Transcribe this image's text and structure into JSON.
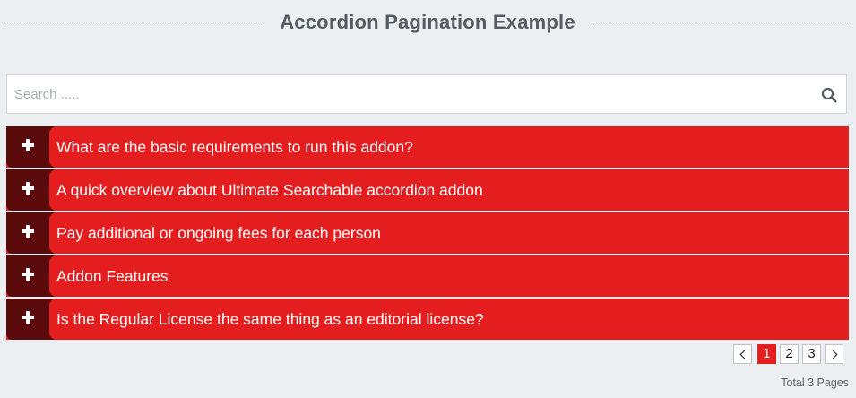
{
  "header": {
    "title": "Accordion Pagination Example"
  },
  "search": {
    "placeholder": "Search .....",
    "value": "",
    "icon": "search-icon"
  },
  "accordion": {
    "colors": {
      "item_bg": "#e41e1f",
      "toggle_bg": "#5b0b0b",
      "text": "#ffffff"
    },
    "items": [
      {
        "label": "What are the basic requirements to run this addon?",
        "icon": "plus-icon",
        "expanded": false
      },
      {
        "label": "A quick overview about Ultimate Searchable accordion addon",
        "icon": "plus-icon",
        "expanded": false
      },
      {
        "label": "Pay additional or ongoing fees for each person",
        "icon": "plus-icon",
        "expanded": false
      },
      {
        "label": "Addon Features",
        "icon": "plus-icon",
        "expanded": false
      },
      {
        "label": "Is the Regular License the same thing as an editorial license?",
        "icon": "plus-icon",
        "expanded": false
      }
    ]
  },
  "pagination": {
    "prev_icon": "chevron-left-icon",
    "next_icon": "chevron-right-icon",
    "pages": [
      "1",
      "2",
      "3"
    ],
    "current_page": "1",
    "total_label": "Total 3 Pages",
    "accent_color": "#e41e1f"
  }
}
